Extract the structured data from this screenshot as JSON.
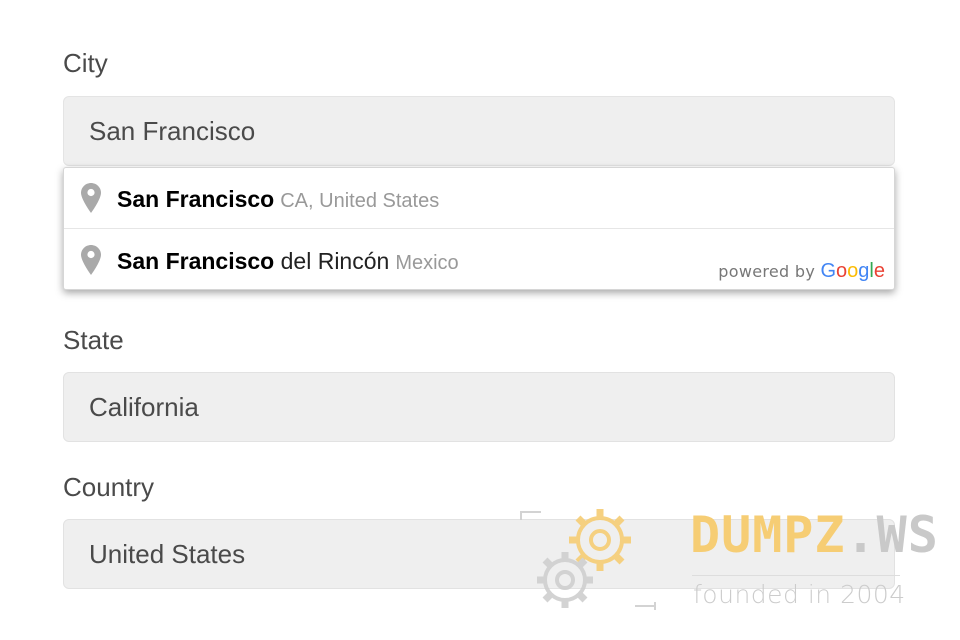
{
  "form": {
    "city": {
      "label": "City",
      "value": "San Francisco"
    },
    "state": {
      "label": "State",
      "value": "California"
    },
    "country": {
      "label": "Country",
      "value": "United States"
    }
  },
  "autocomplete": {
    "items": [
      {
        "match": "San Francisco",
        "rest": "",
        "secondary": "CA, United States",
        "icon": "map-pin-icon"
      },
      {
        "match": "San Francisco",
        "rest": " del Rincón",
        "secondary": "Mexico",
        "icon": "map-pin-icon"
      }
    ],
    "powered_by": "powered by",
    "google_letters": [
      "G",
      "o",
      "o",
      "g",
      "l",
      "e"
    ],
    "google_colors": [
      "#4285f4",
      "#ea4335",
      "#fbbc05",
      "#4285f4",
      "#34a853",
      "#ea4335"
    ]
  },
  "watermark": {
    "brand_part1": "DUMPZ",
    "brand_part2": ".WS",
    "tagline": "founded in 2004",
    "icon": "gears-icon"
  },
  "colors": {
    "input_bg": "#efefef",
    "label_text": "#4a4a4a",
    "secondary_text": "#999999",
    "watermark_orange": "#f6cd74",
    "watermark_gray": "#c9c9c9"
  }
}
